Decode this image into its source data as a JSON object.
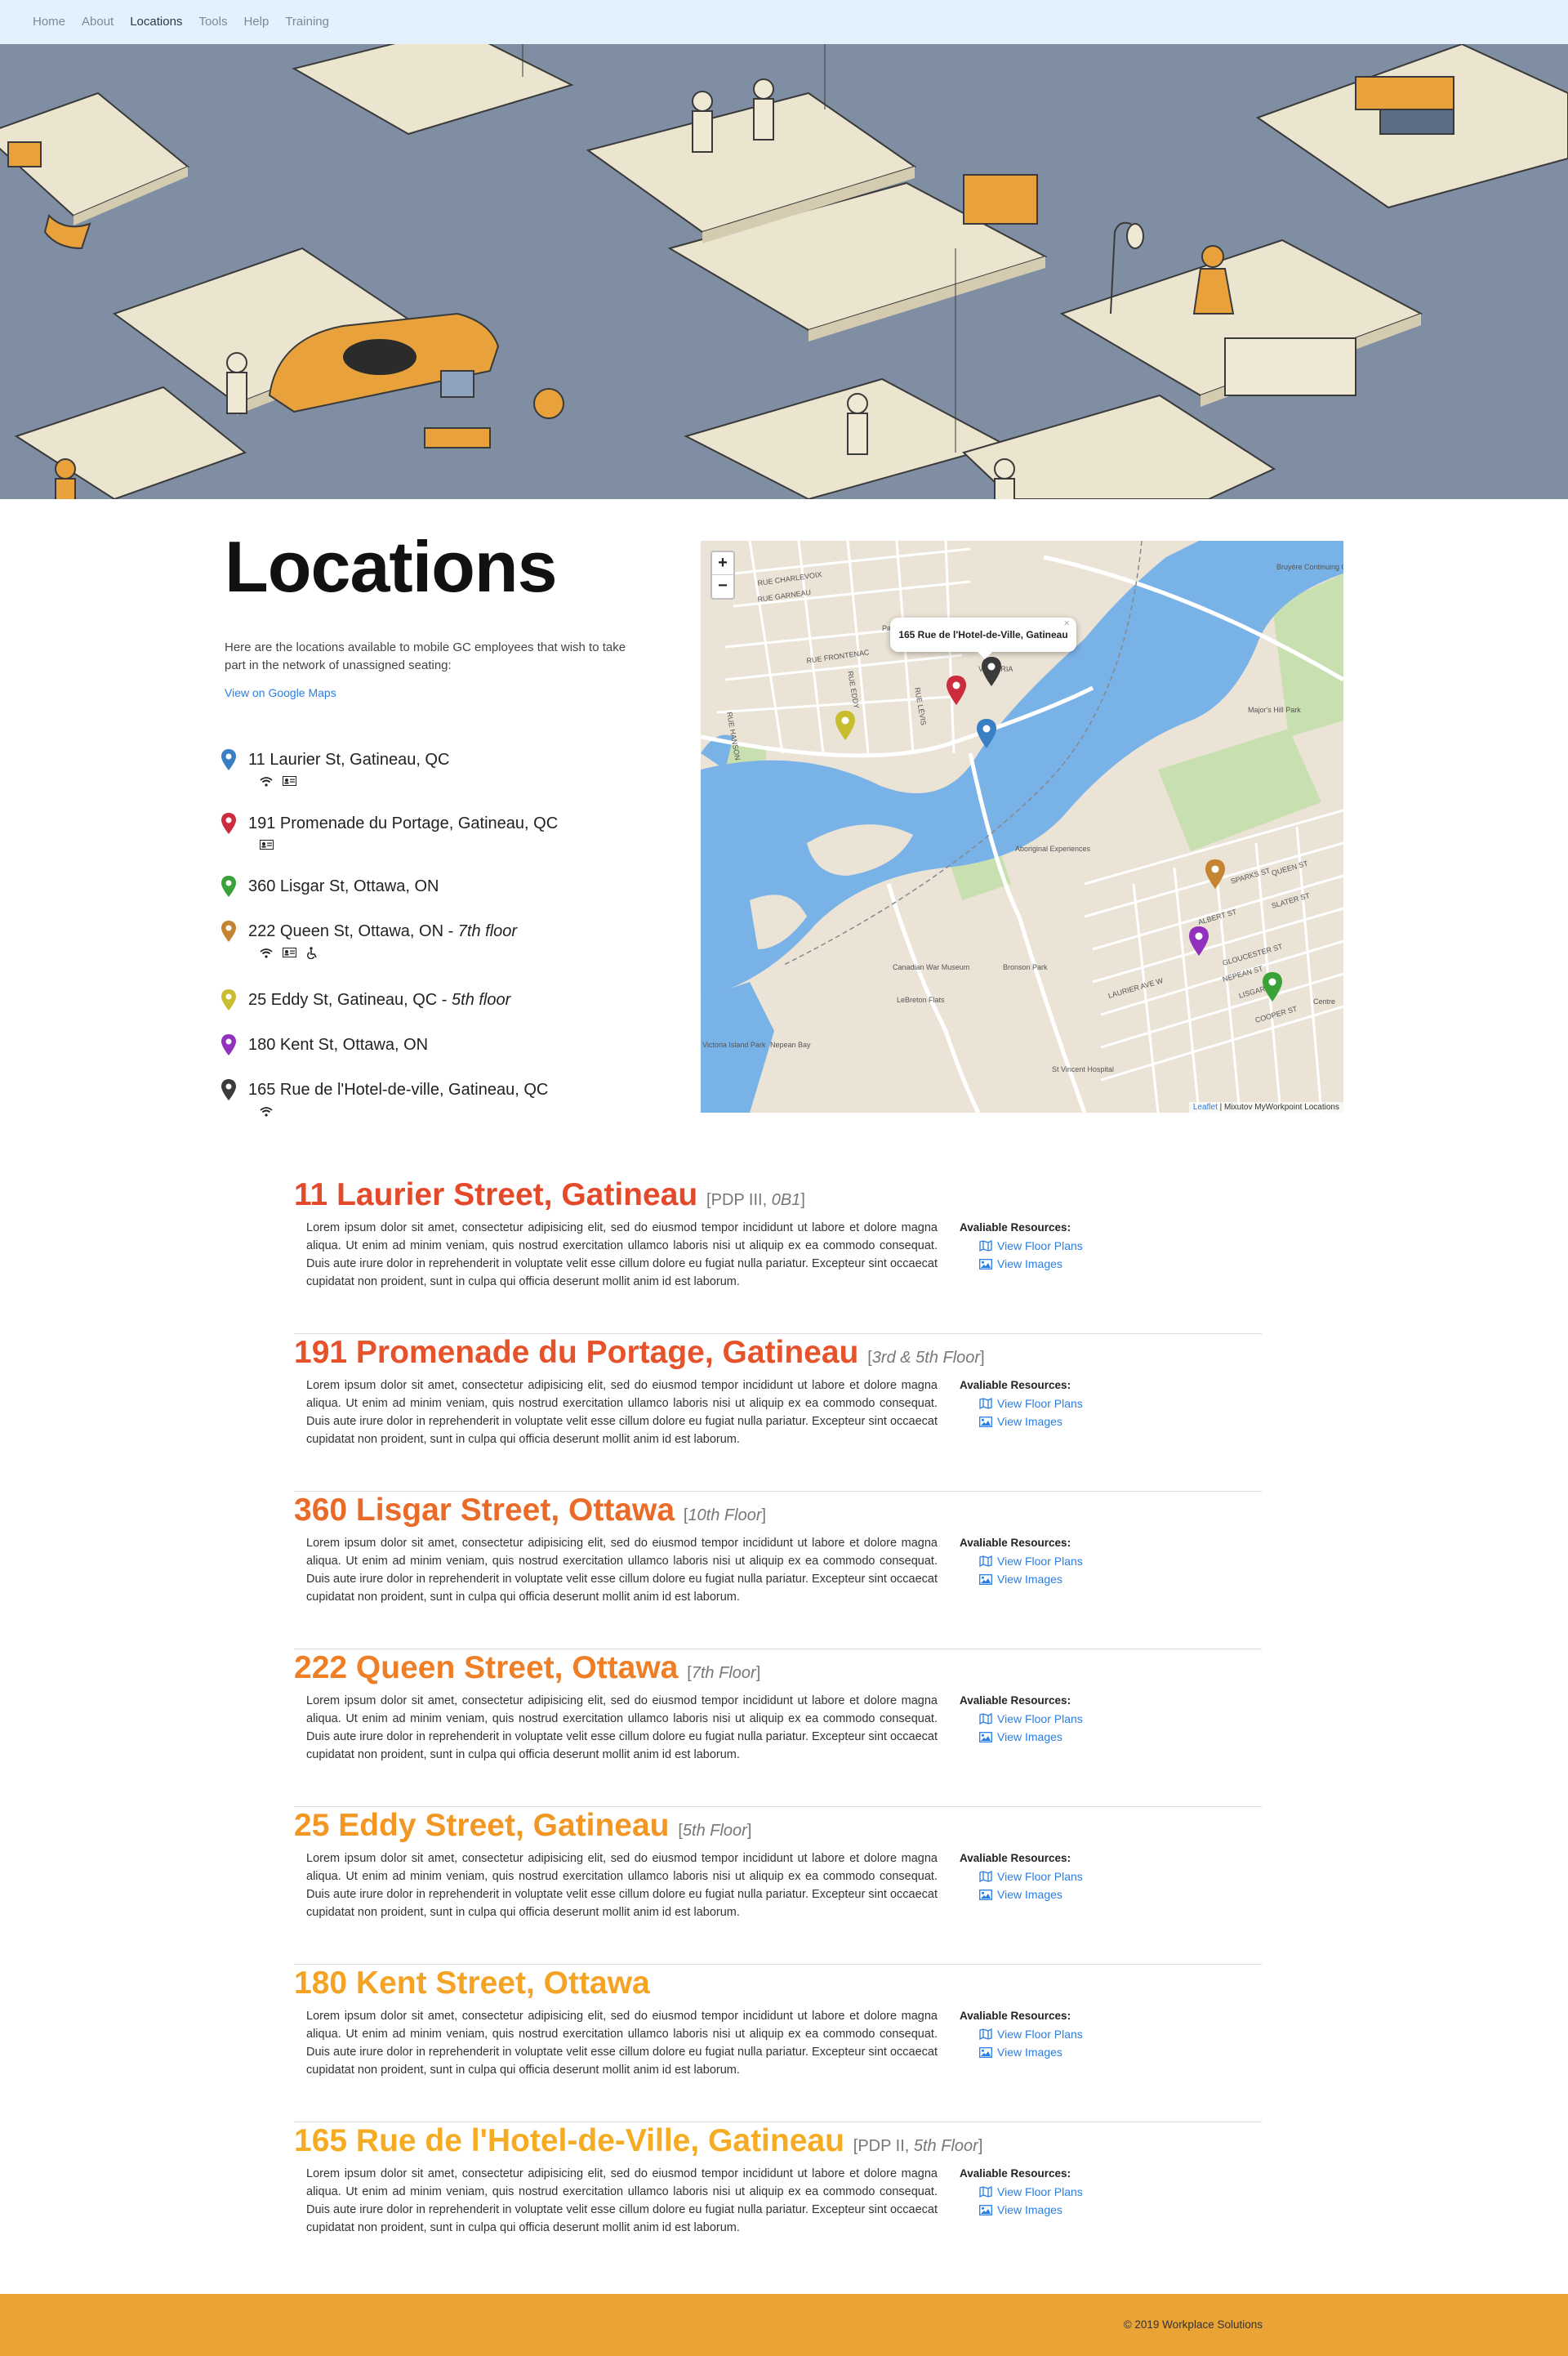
{
  "nav": {
    "items": [
      {
        "label": "Home"
      },
      {
        "label": "About"
      },
      {
        "label": "Locations"
      },
      {
        "label": "Tools"
      },
      {
        "label": "Help"
      },
      {
        "label": "Training"
      }
    ],
    "active": "Locations"
  },
  "intro": {
    "title": "Locations",
    "text": "Here are the locations available to mobile GC employees that wish to take part in the network of unassigned seating:",
    "maps_link": "View on Google Maps"
  },
  "locations": [
    {
      "name": "11 Laurier St, Gatineau, QC",
      "floor": "",
      "color": "#3a7ec4",
      "amenities": [
        "wifi-icon",
        "id-card-icon"
      ]
    },
    {
      "name": "191 Promenade du Portage, Gatineau, QC",
      "floor": "",
      "color": "#cc2c3d",
      "amenities": [
        "id-card-icon"
      ]
    },
    {
      "name": "360 Lisgar St, Ottawa, ON",
      "floor": "",
      "color": "#3ba23a",
      "amenities": []
    },
    {
      "name": "222 Queen St, Ottawa, ON - ",
      "floor": "7th floor",
      "color": "#c58431",
      "amenities": [
        "wifi-icon",
        "id-card-icon",
        "wheelchair-icon"
      ]
    },
    {
      "name": "25 Eddy St, Gatineau, QC - ",
      "floor": "5th floor",
      "color": "#c8bd2e",
      "amenities": []
    },
    {
      "name": "180 Kent St, Ottawa, ON",
      "floor": "",
      "color": "#9231be",
      "amenities": []
    },
    {
      "name": "165 Rue de l'Hotel-de-ville, Gatineau, QC",
      "floor": "",
      "color": "#3b3b3b",
      "amenities": [
        "wifi-icon"
      ]
    }
  ],
  "map": {
    "zoom_in": "+",
    "zoom_out": "−",
    "popup": "165 Rue de l'Hotel-de-Ville, Gatineau",
    "popup_close": "×",
    "attribution_leaflet": "Leaflet",
    "attribution_text": " | Mixutov MyWorkpoint Locations",
    "labels": [
      "RUE CHARLEVOIX",
      "RUE GARNEAU",
      "Parc Fontaine",
      "RUE FRONTENAC",
      "VICTORIA",
      "RUE EDDY",
      "RUE HANSON",
      "RUE LÉVIS",
      "Major's Hill Park",
      "Bruyère Continuing Care",
      "SPARKS ST",
      "QUEEN ST",
      "SLATER ST",
      "ALBERT ST",
      "LAURIER AVE W",
      "GLOUCESTER ST",
      "NEPEAN ST",
      "LISGAR ST",
      "COOPER ST",
      "Aboriginal Experiences",
      "Canadian War Museum",
      "LeBreton Flats",
      "Nepean Bay",
      "Bronson Park",
      "St Vincent Hospital",
      "Centre",
      "Victoria Island Park"
    ]
  },
  "sections": [
    {
      "title": "11 Laurier Street, Gatineau",
      "sub_pre": "[PDP III, ",
      "sub_em": "0B1",
      "sub_post": "]",
      "color": "#e4492a"
    },
    {
      "title": "191 Promenade du Portage, Gatineau",
      "sub_pre": "[",
      "sub_em": "3rd & 5th Floor",
      "sub_post": "]",
      "color": "#e6522a"
    },
    {
      "title": "360 Lisgar Street, Ottawa",
      "sub_pre": "[",
      "sub_em": "10th Floor",
      "sub_post": "]",
      "color": "#ea6a28"
    },
    {
      "title": "222 Queen Street, Ottawa",
      "sub_pre": "[",
      "sub_em": "7th Floor",
      "sub_post": "]",
      "color": "#ee7f26"
    },
    {
      "title": "25 Eddy Street, Gatineau",
      "sub_pre": "[",
      "sub_em": "5th Floor",
      "sub_post": "]",
      "color": "#f29724"
    },
    {
      "title": "180 Kent Street, Ottawa",
      "sub_pre": "",
      "sub_em": "",
      "sub_post": "",
      "color": "#f4a324"
    },
    {
      "title": "165 Rue de l'Hotel-de-Ville, Gatineau",
      "sub_pre": "[PDP II, ",
      "sub_em": "5th Floor",
      "sub_post": "]",
      "color": "#f5ab22"
    }
  ],
  "section_body": "Lorem ipsum dolor sit amet, consectetur adipisicing elit, sed do eiusmod tempor incididunt ut labore et dolore magna aliqua. Ut enim ad minim veniam, quis nostrud exercitation ullamco laboris nisi ut aliquip ex ea commodo consequat. Duis aute irure dolor in reprehenderit in voluptate velit esse cillum dolore eu fugiat nulla pariatur. Excepteur sint occaecat cupidatat non proident, sunt in culpa qui officia deserunt mollit anim id est laborum.",
  "resources": {
    "title": "Avaliable Resources:",
    "floor_plans": "View Floor Plans",
    "images": "View Images"
  },
  "footer": {
    "text": "© 2019 Workplace Solutions",
    "color": "#eaa436"
  }
}
